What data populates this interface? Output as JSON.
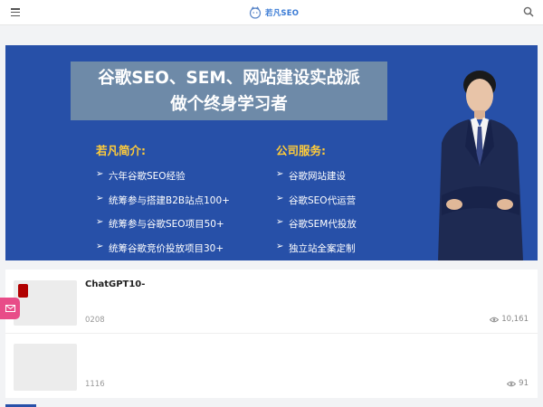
{
  "header": {
    "logo_text": "若凡SEO",
    "menu_icon": "hamburger-menu-icon",
    "search_icon": "search-icon"
  },
  "banner": {
    "headline_line1": "谷歌SEO、SEM、网站建设实战派",
    "headline_line2": "做个终身学习者",
    "left_title": "若凡简介:",
    "left_items": [
      "六年谷歌SEO经验",
      "统筹参与搭建B2B站点100+",
      "统筹参与谷歌SEO项目50+",
      "统筹谷歌竞价投放项目30+"
    ],
    "right_title": "公司服务:",
    "right_items": [
      "谷歌网站建设",
      "谷歌SEO代运营",
      "谷歌SEM代投放",
      "独立站全案定制"
    ],
    "accent_color": "#ffcc3a",
    "background_color": "#2750a8"
  },
  "posts": [
    {
      "title": "ChatGPT10-",
      "date": "0208",
      "views": "10,161"
    },
    {
      "title": "",
      "date": "1116",
      "views": "91"
    }
  ],
  "floating": {
    "mail_icon": "mail-icon"
  }
}
